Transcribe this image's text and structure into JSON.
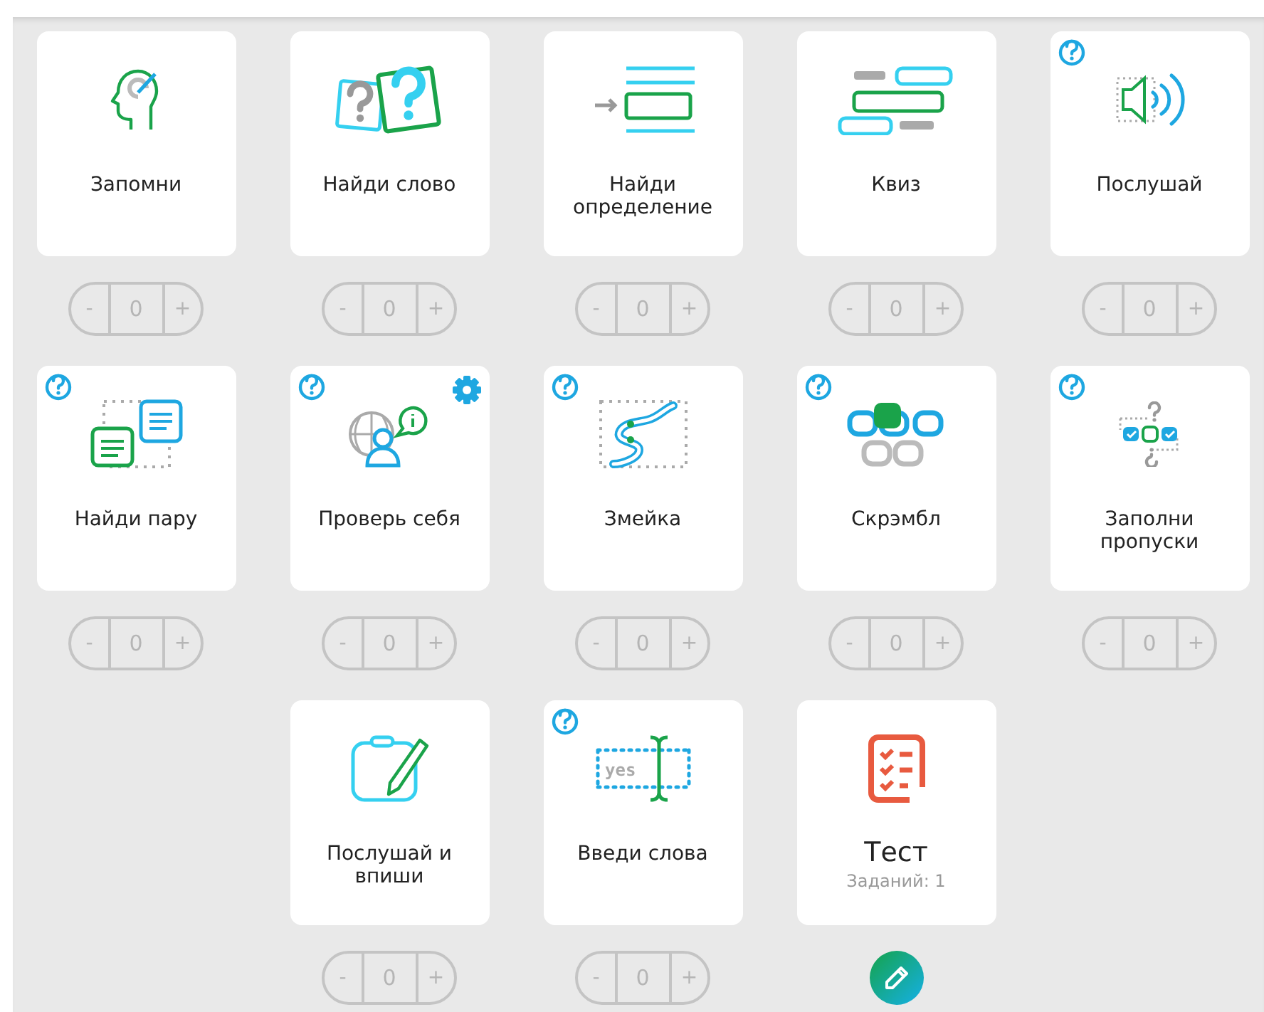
{
  "rows": [
    {
      "cards": [
        {
          "kind": "memorize",
          "label": "Запомни",
          "help": false,
          "settings": false,
          "counter": {
            "minus": "-",
            "value": "0",
            "plus": "+"
          }
        },
        {
          "kind": "find-word",
          "label": "Найди слово",
          "help": false,
          "settings": false,
          "counter": {
            "minus": "-",
            "value": "0",
            "plus": "+"
          }
        },
        {
          "kind": "find-definition",
          "label": "Найди определение",
          "help": false,
          "settings": false,
          "counter": {
            "minus": "-",
            "value": "0",
            "plus": "+"
          }
        },
        {
          "kind": "quiz",
          "label": "Квиз",
          "help": false,
          "settings": false,
          "counter": {
            "minus": "-",
            "value": "0",
            "plus": "+"
          }
        },
        {
          "kind": "listen",
          "label": "Послушай",
          "help": true,
          "settings": false,
          "counter": {
            "minus": "-",
            "value": "0",
            "plus": "+"
          }
        }
      ]
    },
    {
      "cards": [
        {
          "kind": "find-pair",
          "label": "Найди пару",
          "help": true,
          "settings": false,
          "counter": {
            "minus": "-",
            "value": "0",
            "plus": "+"
          }
        },
        {
          "kind": "self-check",
          "label": "Проверь себя",
          "help": true,
          "settings": true,
          "counter": {
            "minus": "-",
            "value": "0",
            "plus": "+"
          }
        },
        {
          "kind": "snake",
          "label": "Змейка",
          "help": true,
          "settings": false,
          "counter": {
            "minus": "-",
            "value": "0",
            "plus": "+"
          }
        },
        {
          "kind": "scramble",
          "label": "Скрэмбл",
          "help": true,
          "settings": false,
          "counter": {
            "minus": "-",
            "value": "0",
            "plus": "+"
          }
        },
        {
          "kind": "fill-gaps",
          "label": "Заполни пропуски",
          "help": true,
          "settings": false,
          "counter": {
            "minus": "-",
            "value": "0",
            "plus": "+"
          }
        }
      ]
    },
    {
      "cards": [
        {
          "kind": "listen-write",
          "label": "Послушай и впиши",
          "help": false,
          "settings": false,
          "counter": {
            "minus": "-",
            "value": "0",
            "plus": "+"
          }
        },
        {
          "kind": "type-words",
          "label": "Введи слова",
          "icon_text": "yes",
          "help": true,
          "settings": false,
          "counter": {
            "minus": "-",
            "value": "0",
            "plus": "+"
          }
        },
        {
          "kind": "test",
          "label": "Тест",
          "subtitle": "Заданий: 1",
          "help": false,
          "settings": false
        }
      ]
    }
  ]
}
